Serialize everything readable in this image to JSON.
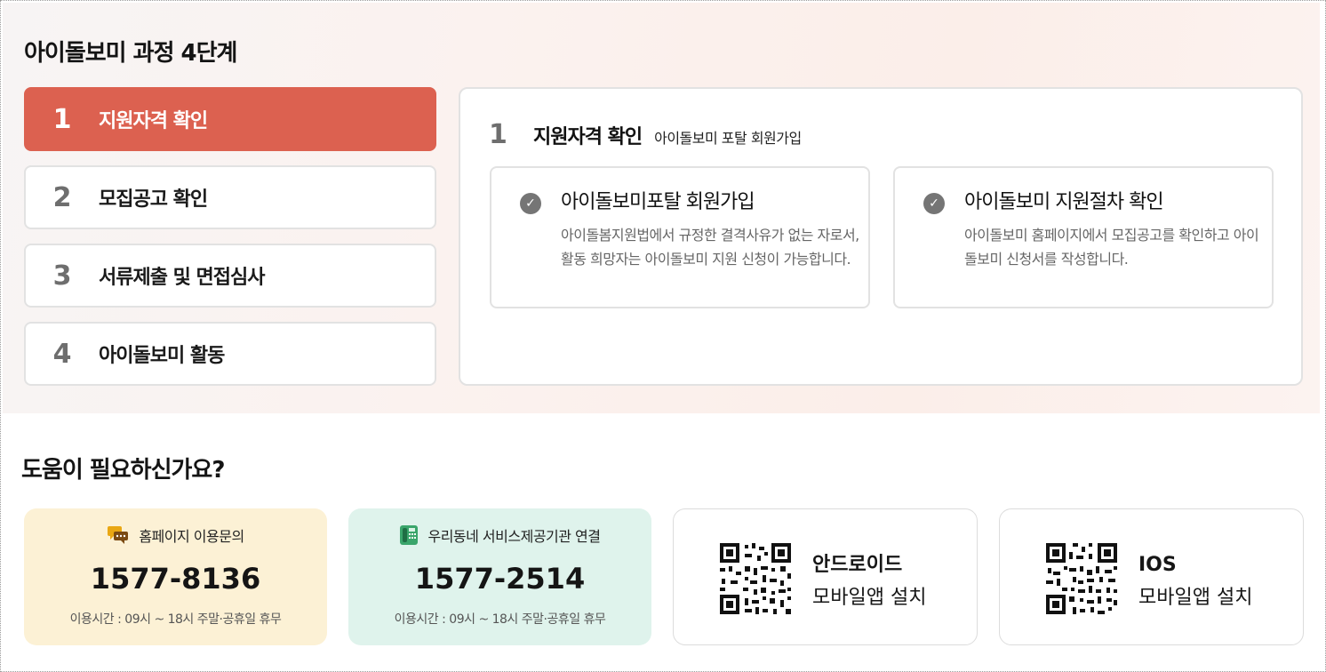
{
  "process": {
    "title": "아이돌보미 과정 4단계",
    "steps": [
      {
        "num": "1",
        "label": "지원자격 확인"
      },
      {
        "num": "2",
        "label": "모집공고 확인"
      },
      {
        "num": "3",
        "label": "서류제출 및 면접심사"
      },
      {
        "num": "4",
        "label": "아이돌보미 활동"
      }
    ],
    "active_step": 1,
    "detail": {
      "num": "1",
      "title": "지원자격 확인",
      "subtitle": "아이돌보미 포탈 회원가입",
      "cards": [
        {
          "title": "아이돌보미포탈 회원가입",
          "desc": "아이돌봄지원법에서 규정한 결격사유가 없는 자로서, 활동 희망자는 아이돌보미 지원 신청이 가능합니다."
        },
        {
          "title": "아이돌보미 지원절차 확인",
          "desc": "아이돌보미 홈페이지에서 모집공고를 확인하고 아이돌보미 신청서를 작성합니다."
        }
      ]
    }
  },
  "help": {
    "title": "도움이 필요하신가요?",
    "contacts": [
      {
        "label": "홈페이지 이용문의",
        "phone": "1577-8136",
        "hours": "이용시간 : 09시 ~ 18시 주말·공휴일 휴무",
        "icon": "chat-bubbles-icon"
      },
      {
        "label": "우리동네 서비스제공기관 연결",
        "phone": "1577-2514",
        "hours": "이용시간 : 09시 ~ 18시 주말·공휴일 휴무",
        "icon": "telephone-icon"
      }
    ],
    "apps": [
      {
        "line1": "안드로이드",
        "line2": "모바일앱 설치",
        "icon": "qr-code-icon"
      },
      {
        "line1": "IOS",
        "line2": "모바일앱 설치",
        "icon": "qr-code-icon"
      }
    ]
  },
  "colors": {
    "accent": "#dc6150",
    "contact_yellow": "#fcf1d5",
    "contact_green": "#dff3ec",
    "step_number_gray": "#6e6e6e"
  }
}
